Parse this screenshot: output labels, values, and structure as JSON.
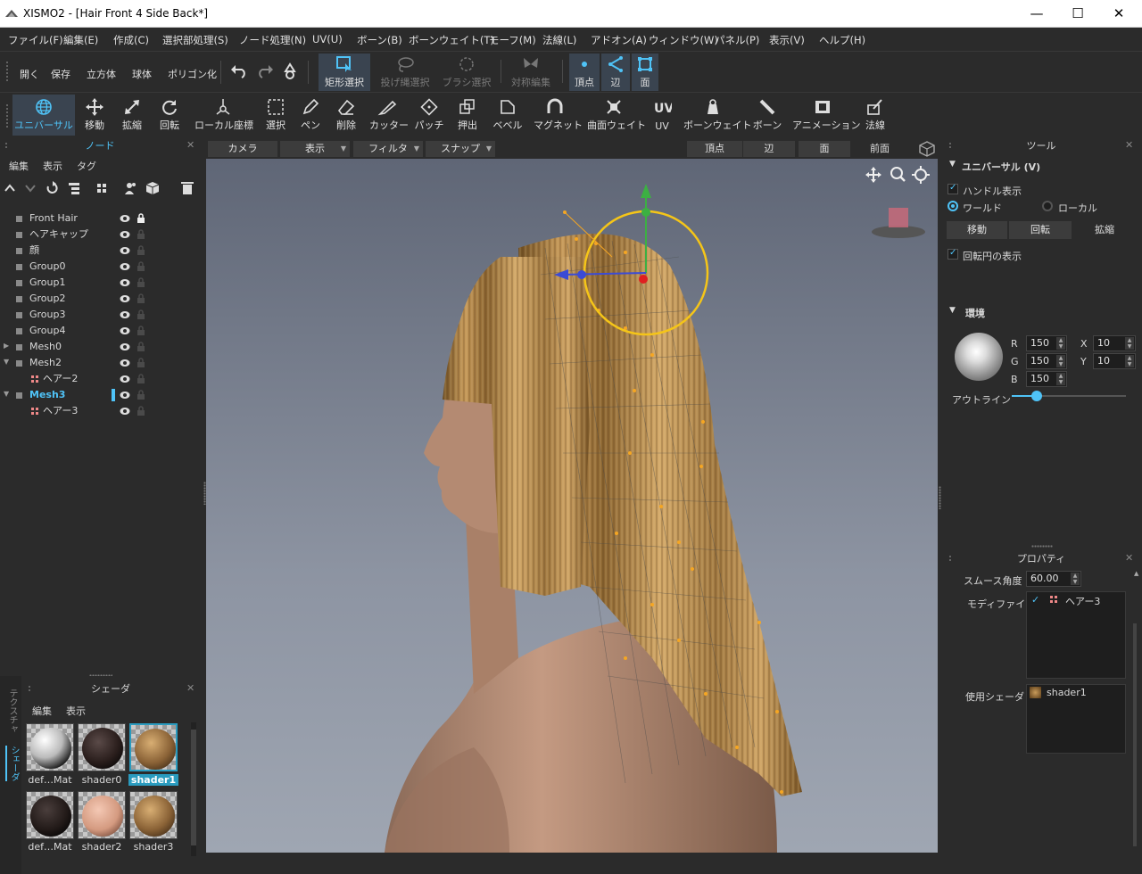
{
  "window": {
    "title": "XISMO2 - [Hair Front 4 Side Back*]",
    "minimize": "—",
    "maximize": "☐",
    "close": "✕"
  },
  "menu": [
    "ファイル(F)",
    "編集(E)",
    "作成(C)",
    "選択部処理(S)",
    "ノード処理(N)",
    "UV(U)",
    "ボーン(B)",
    "ボーンウェイト(T)",
    "モーフ(M)",
    "法線(L)",
    "アドオン(A)",
    "ウィンドウ(W)",
    "パネル(P)",
    "表示(V)",
    "ヘルプ(H)"
  ],
  "toolbar1": {
    "open": "開く",
    "save": "保存",
    "cube": "立方体",
    "sphere": "球体",
    "polygonize": "ポリゴン化",
    "rect_select": "矩形選択",
    "lasso_select": "投げ縄選択",
    "brush_select": "ブラシ選択",
    "sym_edit": "対称編集",
    "vertex": "頂点",
    "edge": "辺",
    "face": "面"
  },
  "toolbar2": [
    "ユニバーサル",
    "移動",
    "拡縮",
    "回転",
    "ローカル座標",
    "選択",
    "ペン",
    "削除",
    "カッター",
    "パッチ",
    "押出",
    "ベベル",
    "マグネット",
    "曲面ウェイト",
    "UV",
    "ボーンウェイト",
    "ボーン",
    "アニメーション",
    "法線"
  ],
  "node_panel": {
    "title": "ノード",
    "tabs": [
      "編集",
      "表示",
      "タグ"
    ],
    "items": [
      {
        "name": "Front Hair",
        "locked": true
      },
      {
        "name": "ヘアキャップ"
      },
      {
        "name": "顔"
      },
      {
        "name": "Group0"
      },
      {
        "name": "Group1"
      },
      {
        "name": "Group2"
      },
      {
        "name": "Group3"
      },
      {
        "name": "Group4"
      },
      {
        "name": "Mesh0"
      },
      {
        "name": "Mesh2"
      },
      {
        "name": "ヘアー2"
      },
      {
        "name": "Mesh3",
        "selected": true
      },
      {
        "name": "ヘアー3"
      }
    ]
  },
  "viewport_bar": {
    "camera": "カメラ",
    "display": "表示",
    "filter": "フィルタ",
    "snap": "スナップ",
    "vertex": "頂点",
    "edge": "辺",
    "face": "面",
    "front": "前面"
  },
  "shader_panel": {
    "title": "シェーダ",
    "tabs": [
      "編集",
      "表示"
    ],
    "side_tabs": [
      "テクスチャ",
      "シェーダ"
    ],
    "items": [
      {
        "name": "def…Mat",
        "color": "#e8e8e8"
      },
      {
        "name": "shader0",
        "color": "#3a2a28"
      },
      {
        "name": "shader1",
        "color": "#b5854a",
        "selected": true
      },
      {
        "name": "def…Mat",
        "color": "#2f2826"
      },
      {
        "name": "shader2",
        "color": "#e0a890"
      },
      {
        "name": "shader3",
        "color": "#b5854a"
      }
    ]
  },
  "tool_panel": {
    "title": "ツール",
    "section": "ユニバーサル (V)",
    "handle_display": "ハンドル表示",
    "world": "ワールド",
    "local": "ローカル",
    "move": "移動",
    "rotate": "回転",
    "scale": "拡縮",
    "rotation_circle": "回転円の表示"
  },
  "environment": {
    "title": "環境",
    "R": "150",
    "G": "150",
    "B": "150",
    "X": "10",
    "Y": "10",
    "outline": "アウトライン",
    "outline_level": 0.22
  },
  "properties": {
    "title": "プロパティ",
    "smooth_angle_label": "スムース角度",
    "smooth_angle": "60.00",
    "modifier_label": "モディファイア",
    "modifier": "ヘアー3",
    "shader_label": "使用シェーダ",
    "shader": "shader1"
  },
  "colors": {
    "accent": "#4fc3f7",
    "bg": "#2b2b2b",
    "gizmo": "#f5c518"
  }
}
